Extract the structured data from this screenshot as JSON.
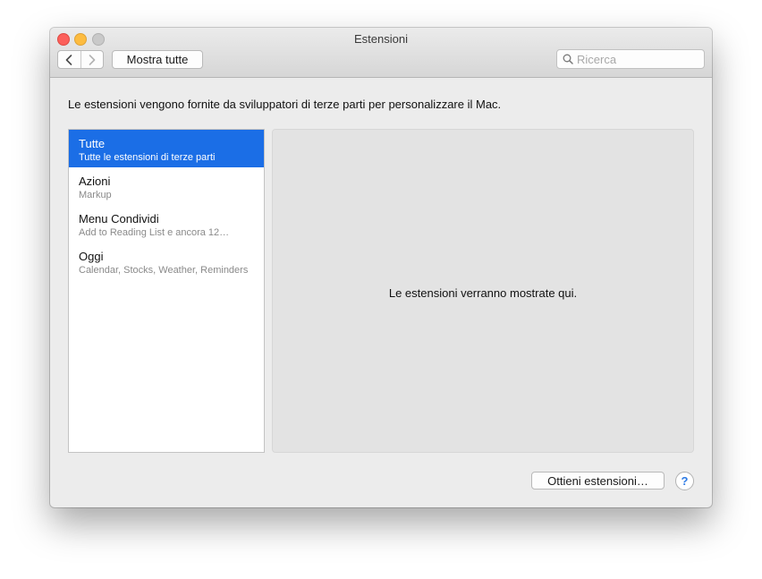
{
  "window": {
    "title": "Estensioni"
  },
  "toolbar": {
    "show_all_label": "Mostra tutte",
    "search_placeholder": "Ricerca",
    "search_value": ""
  },
  "description": "Le estensioni vengono fornite da sviluppatori di terze parti per personalizzare il Mac.",
  "sidebar": {
    "items": [
      {
        "title": "Tutte",
        "subtitle": "Tutte le estensioni di terze parti",
        "selected": true
      },
      {
        "title": "Azioni",
        "subtitle": "Markup",
        "selected": false
      },
      {
        "title": "Menu Condividi",
        "subtitle": "Add to Reading List e ancora 12…",
        "selected": false
      },
      {
        "title": "Oggi",
        "subtitle": "Calendar, Stocks, Weather, Reminders",
        "selected": false
      }
    ]
  },
  "detail": {
    "placeholder": "Le estensioni verranno mostrate qui."
  },
  "footer": {
    "get_extensions_label": "Ottieni estensioni…",
    "help_label": "?"
  },
  "colors": {
    "selection": "#1b6ee6",
    "close": "#fc605b",
    "minimize": "#fdbc40",
    "zoom_disabled": "#c9c9c9",
    "help_accent": "#2d7be5"
  },
  "icons": [
    "close-icon",
    "minimize-icon",
    "zoom-icon",
    "chevron-left-icon",
    "chevron-right-icon",
    "search-icon",
    "help-icon"
  ]
}
